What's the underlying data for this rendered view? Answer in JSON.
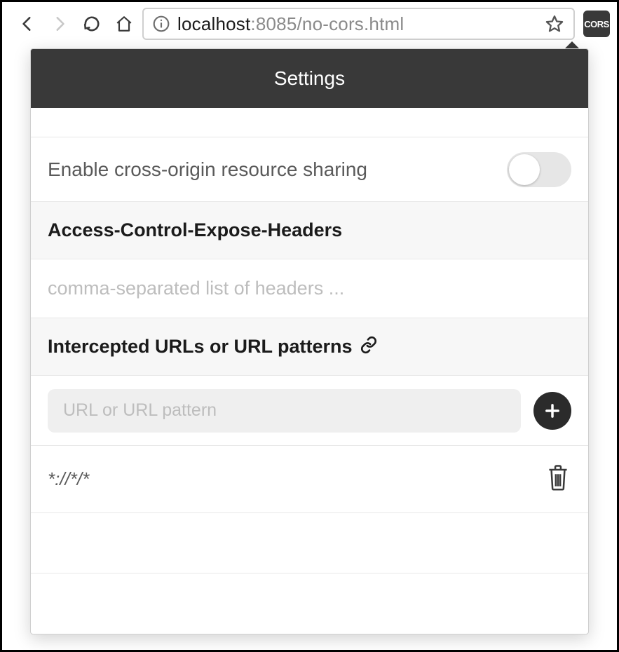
{
  "toolbar": {
    "url": {
      "host": "localhost",
      "rest": ":8085/no-cors.html"
    },
    "extension_badge": "CORS"
  },
  "popup": {
    "title": "Settings",
    "enable_cors": {
      "label": "Enable cross-origin resource sharing",
      "on": false
    },
    "expose_headers": {
      "title": "Access-Control-Expose-Headers",
      "placeholder": "comma-separated list of headers ..."
    },
    "intercepted": {
      "title": "Intercepted URLs or URL patterns",
      "add_placeholder": "URL or URL pattern",
      "patterns": [
        "*://*/*"
      ]
    }
  }
}
